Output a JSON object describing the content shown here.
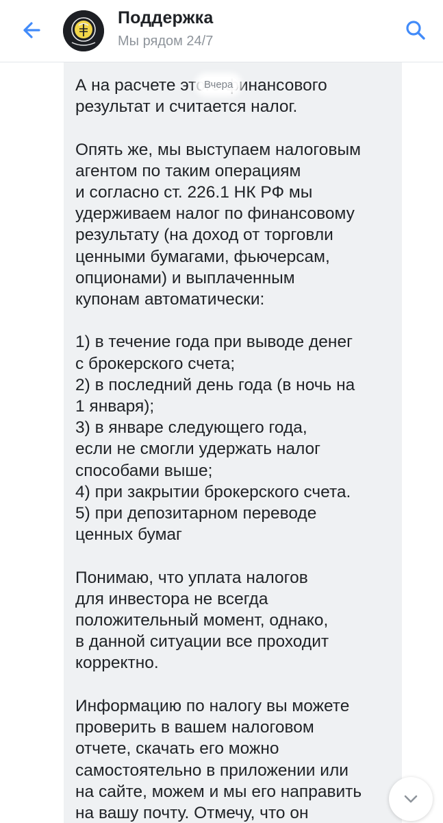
{
  "header": {
    "title": "Поддержка",
    "subtitle": "Мы рядом 24/7",
    "back_icon": "arrow-left-icon",
    "search_icon": "search-icon",
    "accent_color": "#428bf9"
  },
  "chat": {
    "date_chip": "Вчера",
    "bubble_color": "#eff1f3",
    "message_text": "А на расчете этого финансового\nрезультат и считается налог.\n\nОпять же, мы выступаем налоговым\nагентом по таким операциям\nи согласно ст. 226.1 НК РФ мы\nудерживаем налог по финансовому\nрезультату (на доход от торговли\nценными бумагами, фьючерсам,\nопционами) и выплаченным\nкупонам автоматически:\n\n1) в течение года при выводе денег\nс брокерского счета;\n2) в последний день года (в ночь на\n1 января);\n3) в январе следующего года,\nесли не смогли удержать налог\nспособами выше;\n4) при закрытии брокерского счета.\n5) при депозитарном переводе\nценных бумаг\n\nПонимаю, что уплата налогов\nдля инвестора не всегда\nположительный момент, однако,\nв данной ситуации все проходит\nкорректно.\n\nИнформацию по налогу вы можете\nпроверить в вашем налоговом\nотчете, скачать его можно\nсамостоятельно в приложении или\nна сайте, можем и мы его направить\nна вашу почту. Отмечу, что он",
    "scroll_icon": "chevron-down-icon"
  }
}
